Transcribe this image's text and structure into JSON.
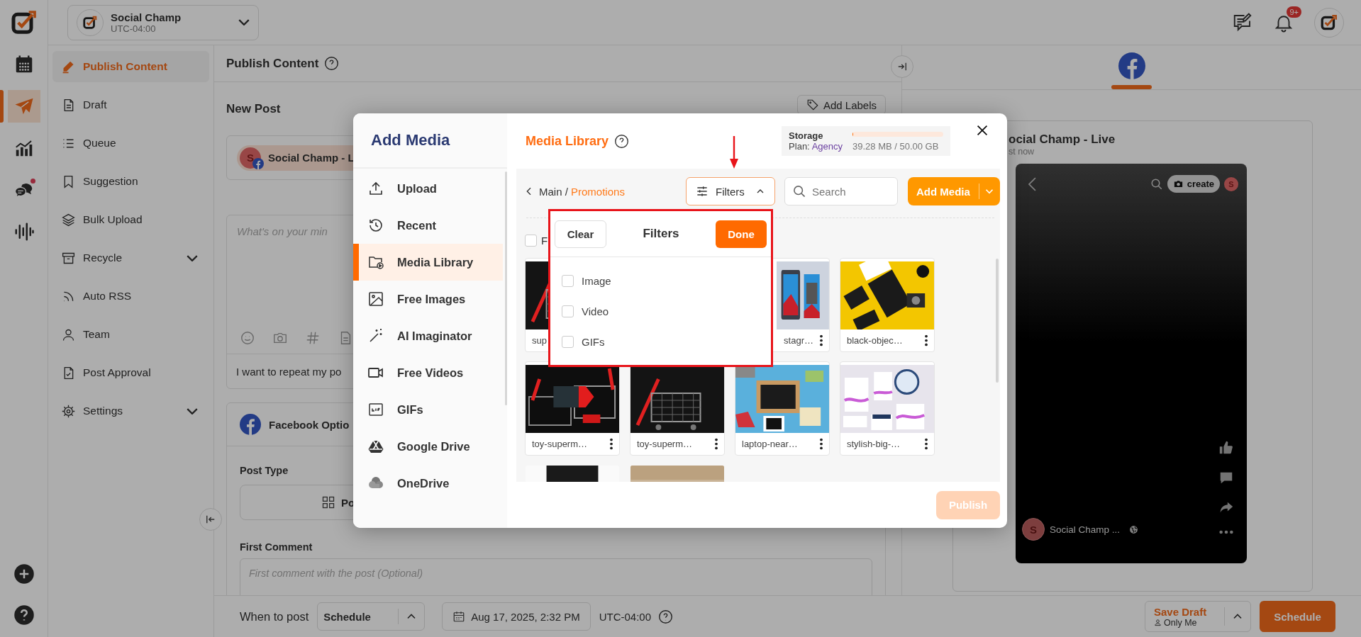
{
  "rail": {
    "items": [
      {
        "kind": "calendar",
        "selected": false,
        "alert": false
      },
      {
        "kind": "publish",
        "selected": true,
        "alert": false
      },
      {
        "kind": "analytics",
        "selected": false,
        "alert": false
      },
      {
        "kind": "inbox",
        "selected": false,
        "alert": true
      },
      {
        "kind": "listening",
        "selected": false,
        "alert": false
      }
    ],
    "bottom": [
      {
        "kind": "add"
      },
      {
        "kind": "help"
      }
    ]
  },
  "workspace": {
    "name": "Social Champ",
    "timezone": "UTC-04:00"
  },
  "header_actions": {
    "notification_badge": "9+"
  },
  "sidebar": {
    "items": [
      {
        "label": "Publish Content",
        "selected": true,
        "expandable": false
      },
      {
        "label": "Draft",
        "selected": false,
        "expandable": false
      },
      {
        "label": "Queue",
        "selected": false,
        "expandable": false
      },
      {
        "label": "Suggestion",
        "selected": false,
        "expandable": false
      },
      {
        "label": "Bulk Upload",
        "selected": false,
        "expandable": false
      },
      {
        "label": "Recycle",
        "selected": false,
        "expandable": true
      },
      {
        "label": "Auto RSS",
        "selected": false,
        "expandable": false
      },
      {
        "label": "Team",
        "selected": false,
        "expandable": false
      },
      {
        "label": "Post Approval",
        "selected": false,
        "expandable": false
      },
      {
        "label": "Settings",
        "selected": false,
        "expandable": true
      }
    ]
  },
  "main": {
    "title": "Publish Content",
    "subtitle": "New Post",
    "add_labels": "Add Labels",
    "account": {
      "initial": "S",
      "name": "Social Champ - L"
    },
    "editor": {
      "placeholder": "What's on your min",
      "note": "I want to repeat my po"
    },
    "facebook_options": {
      "title": "Facebook Optio",
      "post_type_label": "Post Type",
      "post_type_button": "Po",
      "first_comment_label": "First Comment",
      "first_comment_placeholder": "First comment with the post (Optional)"
    }
  },
  "footer": {
    "when_label": "When to post",
    "mode": "Schedule",
    "date": "Aug 17, 2025, 2:32 PM",
    "timezone": "UTC-04:00",
    "save_draft": "Save Draft",
    "visibility": "Only Me",
    "schedule": "Schedule"
  },
  "preview": {
    "tabs": [
      {
        "kind": "facebook",
        "selected": true
      }
    ],
    "title": "ocial Champ - Live",
    "time": "st now",
    "create": "create",
    "avatar": "S",
    "page_avatar": "S",
    "page_name": "Social Champ ..."
  },
  "modal": {
    "title": "Add Media",
    "nav": [
      {
        "label": "Upload",
        "selected": false
      },
      {
        "label": "Recent",
        "selected": false
      },
      {
        "label": "Media Library",
        "selected": true
      },
      {
        "label": "Free Images",
        "selected": false
      },
      {
        "label": "AI Imaginator",
        "selected": false
      },
      {
        "label": "Free Videos",
        "selected": false
      },
      {
        "label": "GIFs",
        "selected": false
      },
      {
        "label": "Google Drive",
        "selected": false
      },
      {
        "label": "OneDrive",
        "selected": false
      }
    ],
    "heading": "Media Library",
    "storage": {
      "label": "Storage",
      "plan_label": "Plan:",
      "plan": "Agency",
      "level": 0.001,
      "usage": "39.28 MB / 50.00 GB"
    },
    "breadcrumb": {
      "root": "Main",
      "separator": "/",
      "current": "Promotions"
    },
    "filters_button": {
      "label": "Filters",
      "expanded": true
    },
    "search": {
      "placeholder": "Search"
    },
    "add_media": "Add Media",
    "select_all": {
      "label": "F",
      "checked": false
    },
    "cards": [
      {
        "kind": "file",
        "name": "sup"
      },
      {
        "kind": "file",
        "name": "stagr…"
      },
      {
        "kind": "file",
        "name": "black-objec…"
      },
      {
        "kind": "file",
        "name": "toy-superm…"
      },
      {
        "kind": "file",
        "name": "toy-superm…"
      },
      {
        "kind": "file",
        "name": "laptop-near…"
      },
      {
        "kind": "file",
        "name": "stylish-big-…"
      },
      {
        "kind": "picture"
      },
      {
        "kind": "picture"
      }
    ],
    "filters_panel": {
      "highlighted": true,
      "clear": "Clear",
      "title": "Filters",
      "done": "Done",
      "options": [
        {
          "label": "Image",
          "checked": false
        },
        {
          "label": "Video",
          "checked": false
        },
        {
          "label": "GIFs",
          "checked": false
        }
      ]
    },
    "annotation_arrow": true,
    "publish": {
      "label": "Publish",
      "disabled": true
    }
  }
}
